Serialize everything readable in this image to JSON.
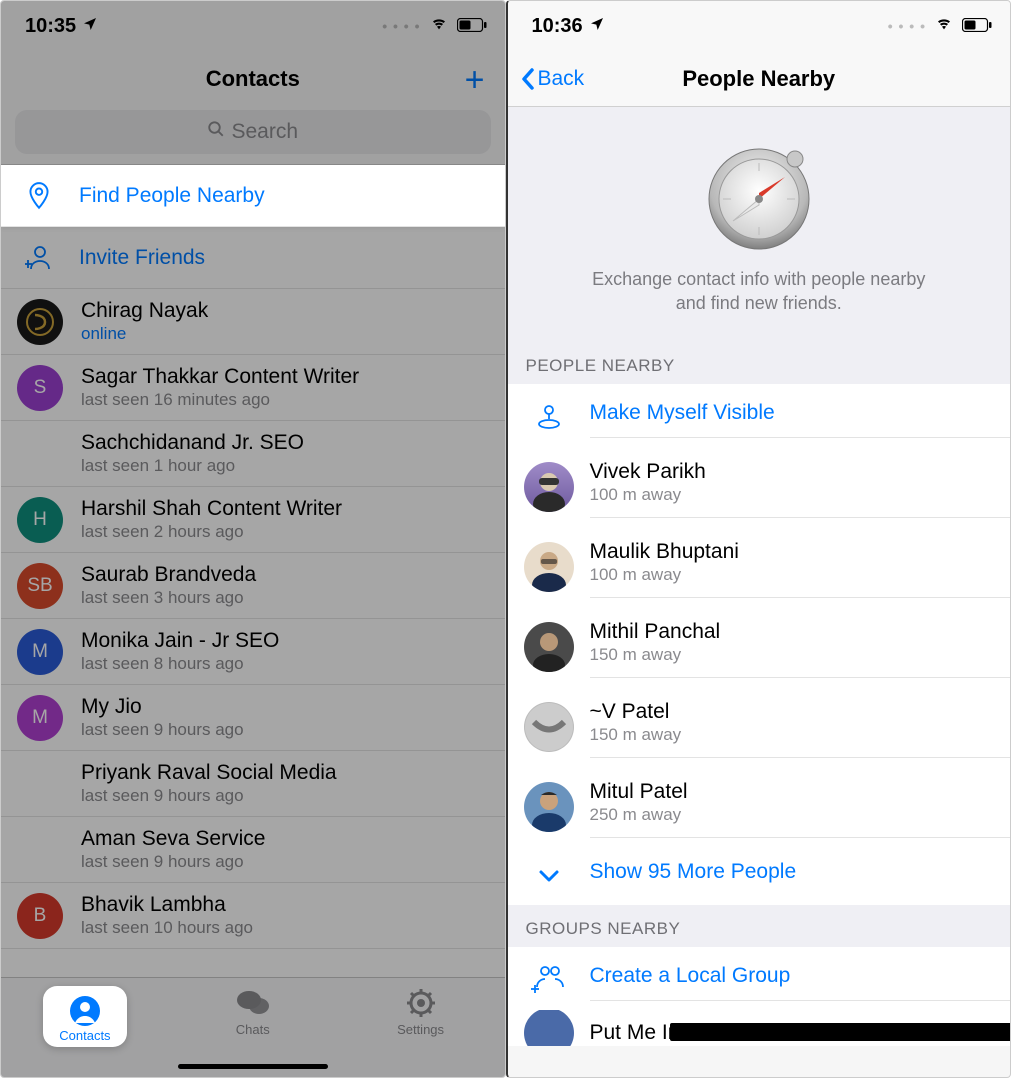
{
  "left": {
    "status": {
      "time": "10:35",
      "dots": "• • • •"
    },
    "nav": {
      "title": "Contacts",
      "plus": "+"
    },
    "search": {
      "placeholder": "Search"
    },
    "actions": {
      "find_nearby": "Find People Nearby",
      "invite": "Invite Friends"
    },
    "contacts": [
      {
        "name": "Chirag Nayak",
        "sub": "online",
        "online": true,
        "avatarColor": "#1a1a1a",
        "initial": "",
        "logo": true
      },
      {
        "name": "Sagar Thakkar Content Writer",
        "sub": "last seen 16 minutes ago",
        "avatarColor": "#9b3fd1",
        "initial": "S"
      },
      {
        "name": "Sachchidanand Jr. SEO",
        "sub": "last seen 1 hour ago",
        "noAvatar": true
      },
      {
        "name": "Harshil Shah Content Writer",
        "sub": "last seen 2 hours ago",
        "avatarColor": "#0f8f7e",
        "initial": "H"
      },
      {
        "name": "Saurab Brandveda",
        "sub": "last seen 3 hours ago",
        "avatarColor": "#d94a2b",
        "initial": "SB"
      },
      {
        "name": "Monika Jain - Jr SEO",
        "sub": "last seen 8 hours ago",
        "avatarColor": "#2a5bd7",
        "initial": "M"
      },
      {
        "name": "My Jio",
        "sub": "last seen 9 hours ago",
        "avatarColor": "#b03fd1",
        "initial": "M"
      },
      {
        "name": "Priyank Raval Social Media",
        "sub": "last seen 9 hours ago",
        "noAvatar": true
      },
      {
        "name": "Aman Seva Service",
        "sub": "last seen 9 hours ago",
        "noAvatar": true
      },
      {
        "name": "Bhavik Lambha",
        "sub": "last seen 10 hours ago",
        "avatarColor": "#d63a2b",
        "initial": "B"
      }
    ],
    "tabs": {
      "contacts": "Contacts",
      "chats": "Chats",
      "settings": "Settings"
    }
  },
  "right": {
    "status": {
      "time": "10:36",
      "dots": "• • • •"
    },
    "nav": {
      "back": "Back",
      "title": "People Nearby"
    },
    "hero": {
      "text": "Exchange contact info with people nearby and find new friends."
    },
    "sections": {
      "people_header": "PEOPLE NEARBY",
      "groups_header": "GROUPS NEARBY"
    },
    "make_visible": "Make Myself Visible",
    "people": [
      {
        "name": "Vivek Parikh",
        "dist": "100 m away",
        "bg": "#7c6fae"
      },
      {
        "name": "Maulik Bhuptani",
        "dist": "100 m away",
        "bg": "#d8cabb"
      },
      {
        "name": "Mithil Panchal",
        "dist": "150 m away",
        "bg": "#5c5c5c"
      },
      {
        "name": "~V Patel",
        "dist": "150 m away",
        "bg": "#aeaeae"
      },
      {
        "name": "Mitul Patel",
        "dist": "250 m away",
        "bg": "#5b88b5"
      }
    ],
    "show_more": "Show 95 More People",
    "create_group": "Create a Local Group",
    "partial_group": "Put Me In Touch With Ahmedabad"
  }
}
